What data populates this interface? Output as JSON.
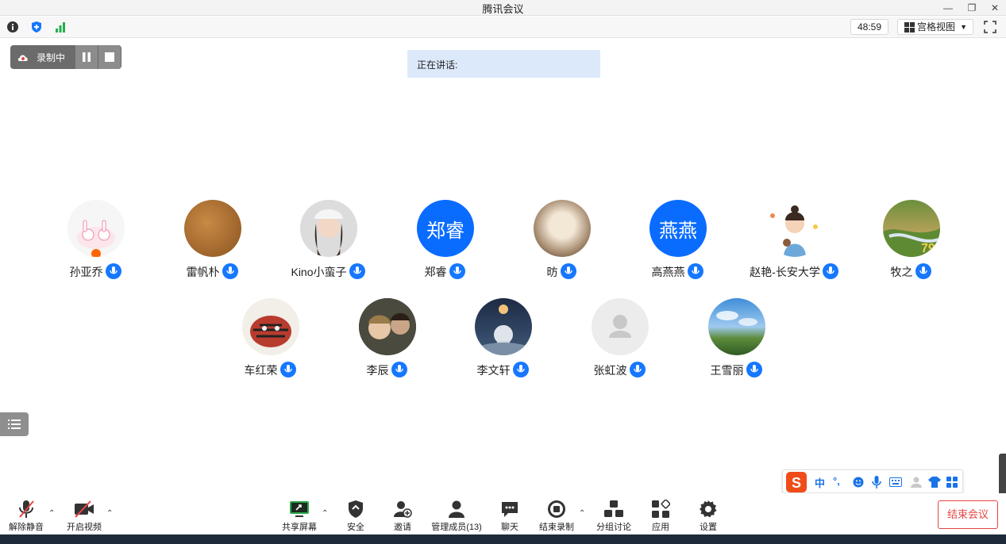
{
  "window": {
    "title": "腾讯会议"
  },
  "topbar": {
    "timer": "48:59",
    "view_mode": "宫格视图"
  },
  "recording": {
    "label": "录制中"
  },
  "speaking": {
    "label": "正在讲话:"
  },
  "participants": [
    {
      "name": "孙亚乔"
    },
    {
      "name": "雷帆朴"
    },
    {
      "name": "Kino小蛮子"
    },
    {
      "name": "郑睿",
      "avatar_text": "郑睿"
    },
    {
      "name": "昉"
    },
    {
      "name": "高燕燕",
      "avatar_text": "燕燕"
    },
    {
      "name": "赵艳-长安大学"
    },
    {
      "name": "牧之"
    },
    {
      "name": "车红荣"
    },
    {
      "name": "李辰"
    },
    {
      "name": "李文轩"
    },
    {
      "name": "张虹波"
    },
    {
      "name": "王雪丽"
    }
  ],
  "ime": {
    "lang": "中",
    "punct": "°,"
  },
  "bottom": {
    "unmute": "解除静音",
    "video": "开启视频",
    "share": "共享屏幕",
    "security": "安全",
    "invite": "邀请",
    "members": "管理成员(13)",
    "chat": "聊天",
    "stop_record": "结束录制",
    "breakout": "分组讨论",
    "apps": "应用",
    "settings": "设置",
    "end_meeting": "结束会议"
  },
  "colors": {
    "accent": "#1677ff",
    "danger": "#e64545",
    "speaking_bg": "#dce9fb"
  }
}
